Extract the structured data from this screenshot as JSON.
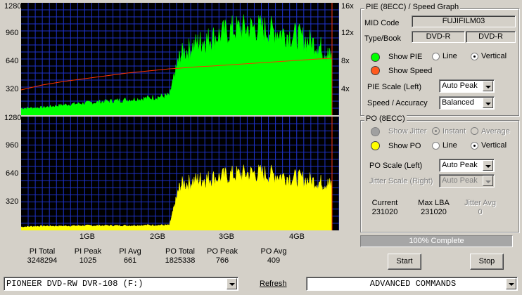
{
  "charts": {
    "top_y_ticks": [
      "1280",
      "960",
      "640",
      "320"
    ],
    "top_right_ticks": [
      "16x",
      "12x",
      "8x",
      "4x"
    ],
    "bottom_y_ticks": [
      "1280",
      "960",
      "640",
      "320"
    ],
    "x_ticks": [
      "1GB",
      "2GB",
      "3GB",
      "4GB"
    ],
    "pie_color": "#00ff00",
    "po_color": "#ffff00",
    "speed_color": "#ff3300",
    "grid_color": "#1e32c8",
    "bg_color": "#000000"
  },
  "chart_data": [
    {
      "type": "area",
      "title": "PIE (8ECC)",
      "x": [
        0.0,
        0.3,
        0.6,
        0.9,
        1.2,
        1.5,
        1.8,
        2.1,
        2.25,
        2.5,
        2.7,
        3.0,
        3.3,
        3.6,
        3.9,
        4.2,
        4.4
      ],
      "series": [
        {
          "name": "PIE",
          "values": [
            80,
            90,
            120,
            140,
            160,
            180,
            200,
            230,
            700,
            840,
            900,
            1000,
            1020,
            980,
            920,
            820,
            660
          ]
        },
        {
          "name": "Speed",
          "values": [
            3.6,
            4.3,
            4.8,
            5.2,
            5.6,
            6.0,
            6.3,
            6.6,
            6.7,
            6.9,
            7.0,
            7.2,
            7.4,
            7.6,
            7.8,
            8.0,
            8.1
          ]
        }
      ],
      "xlabel": "",
      "ylabel": "",
      "ylim": [
        0,
        1280
      ],
      "y2lim": [
        0,
        16
      ],
      "grid": true
    },
    {
      "type": "area",
      "title": "PO (8ECC)",
      "x": [
        0.0,
        0.3,
        0.6,
        0.9,
        1.2,
        1.5,
        1.8,
        2.1,
        2.25,
        2.5,
        2.7,
        3.0,
        3.3,
        3.6,
        3.9,
        4.2,
        4.4
      ],
      "series": [
        {
          "name": "PO",
          "values": [
            40,
            50,
            50,
            55,
            55,
            55,
            60,
            60,
            520,
            580,
            600,
            640,
            660,
            640,
            600,
            560,
            520
          ]
        }
      ],
      "xlabel": "",
      "ylabel": "",
      "ylim": [
        0,
        1280
      ],
      "grid": true
    }
  ],
  "stats": [
    {
      "label": "PI Total",
      "value": "3248294"
    },
    {
      "label": "PI Peak",
      "value": "1025"
    },
    {
      "label": "PI Avg",
      "value": "661"
    },
    {
      "label": "PO Total",
      "value": "1825338"
    },
    {
      "label": "PO Peak",
      "value": "766"
    },
    {
      "label": "PO Avg",
      "value": "409"
    }
  ],
  "pie_panel": {
    "title": "PIE (8ECC) / Speed Graph",
    "mid_code_label": "MID Code",
    "mid_code_value": "FUJIFILM03",
    "type_book_label": "Type/Book",
    "type_value": "DVD-R",
    "book_value": "DVD-R",
    "show_pie": "Show PIE",
    "line": "Line",
    "vertical": "Vertical",
    "show_speed": "Show Speed",
    "pie_scale_label": "PIE Scale (Left)",
    "pie_scale_value": "Auto Peak",
    "speed_acc_label": "Speed / Accuracy",
    "speed_acc_value": "Balanced"
  },
  "po_panel": {
    "title": "PO (8ECC)",
    "show_jitter": "Show Jitter",
    "instant": "Instant",
    "average": "Average",
    "show_po": "Show PO",
    "line": "Line",
    "vertical": "Vertical",
    "po_scale_label": "PO Scale (Left)",
    "po_scale_value": "Auto Peak",
    "jitter_scale_label": "Jitter Scale (Right)",
    "jitter_scale_value": "Auto Peak",
    "current_label": "Current",
    "current_value": "231020",
    "max_lba_label": "Max LBA",
    "max_lba_value": "231020",
    "jitter_avg_label": "Jitter Avg",
    "jitter_avg_value": "0"
  },
  "progress": {
    "text": "100% Complete",
    "fraction": 1.0
  },
  "buttons": {
    "start": "Start",
    "stop": "Stop",
    "refresh": "Refresh"
  },
  "bottom": {
    "drive": "PIONEER DVD-RW  DVR-108  (F:)",
    "advanced": "ADVANCED COMMANDS"
  }
}
